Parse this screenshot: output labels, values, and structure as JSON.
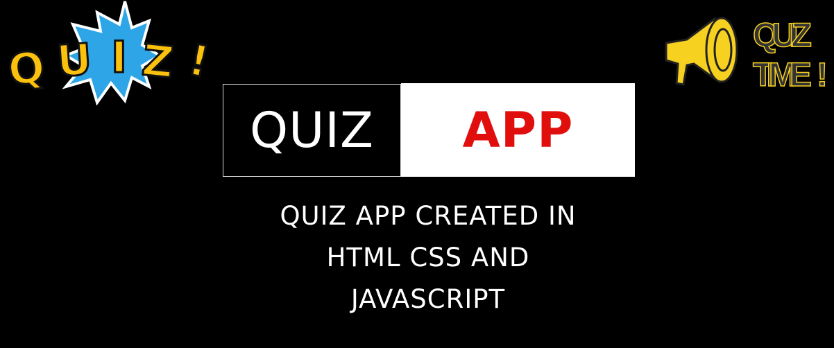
{
  "logos": {
    "left": "QUIZ!",
    "right_line1": "QUIZ",
    "right_line2": "TIME"
  },
  "title": {
    "left": "QUIZ",
    "right": "APP"
  },
  "subtitle": {
    "lines": [
      "QUIZ APP CREATED IN",
      "HTML CSS AND",
      "JAVASCRIPT"
    ]
  },
  "colors": {
    "accent": "#e10e0e",
    "yellow": "#fbc10d",
    "blue": "#2ea5e6"
  }
}
